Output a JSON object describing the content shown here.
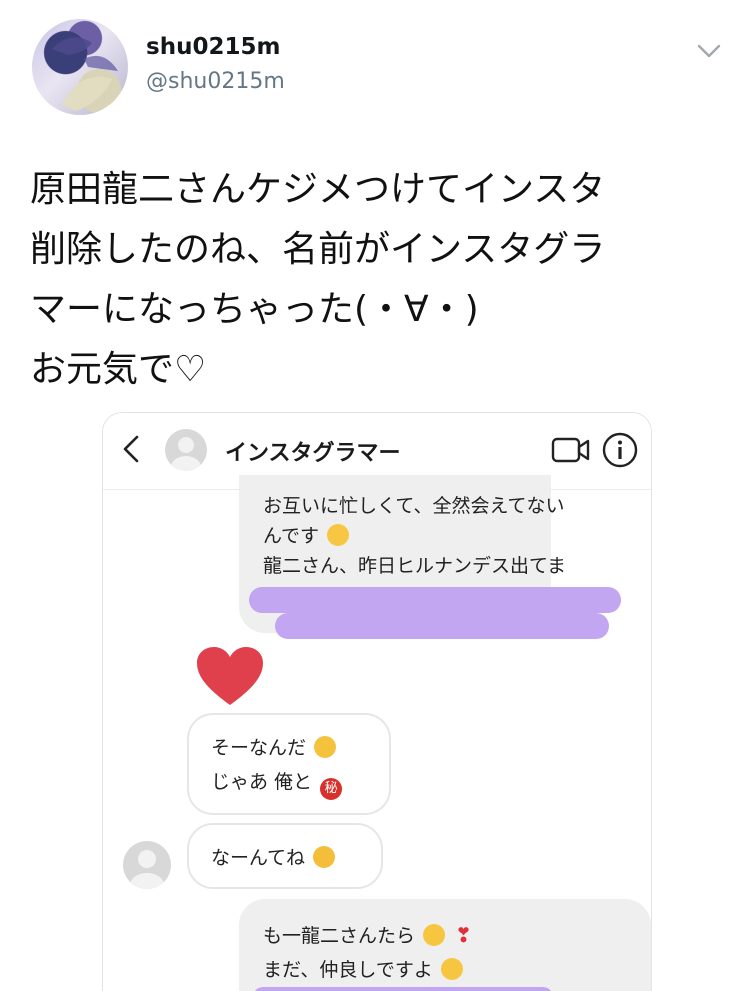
{
  "tweet": {
    "display_name": "shu0215m",
    "username": "@shu0215m",
    "text_lines": [
      "原田龍二さんケジメつけてインスタ",
      "削除したのね、名前がインスタグラ",
      "マーになっちゃった(・∀・)",
      "お元気で♡"
    ]
  },
  "dm": {
    "contact_name": "インスタグラマー",
    "messages": {
      "out1": [
        "お互いに忙しくて、全然会えてない",
        "んです",
        "龍二さん、昨日ヒルナンデス出てま"
      ],
      "in1": [
        "そーなんだ",
        "じゃあ 俺と"
      ],
      "in2": [
        "なーんてね"
      ],
      "out2": [
        "も一龍二さんたら",
        "まだ、仲良しですよ"
      ]
    },
    "secret_emoji": "秘"
  },
  "colors": {
    "scribble": "#c3a6f1",
    "heart": "#e0404b",
    "username": "#657786"
  }
}
